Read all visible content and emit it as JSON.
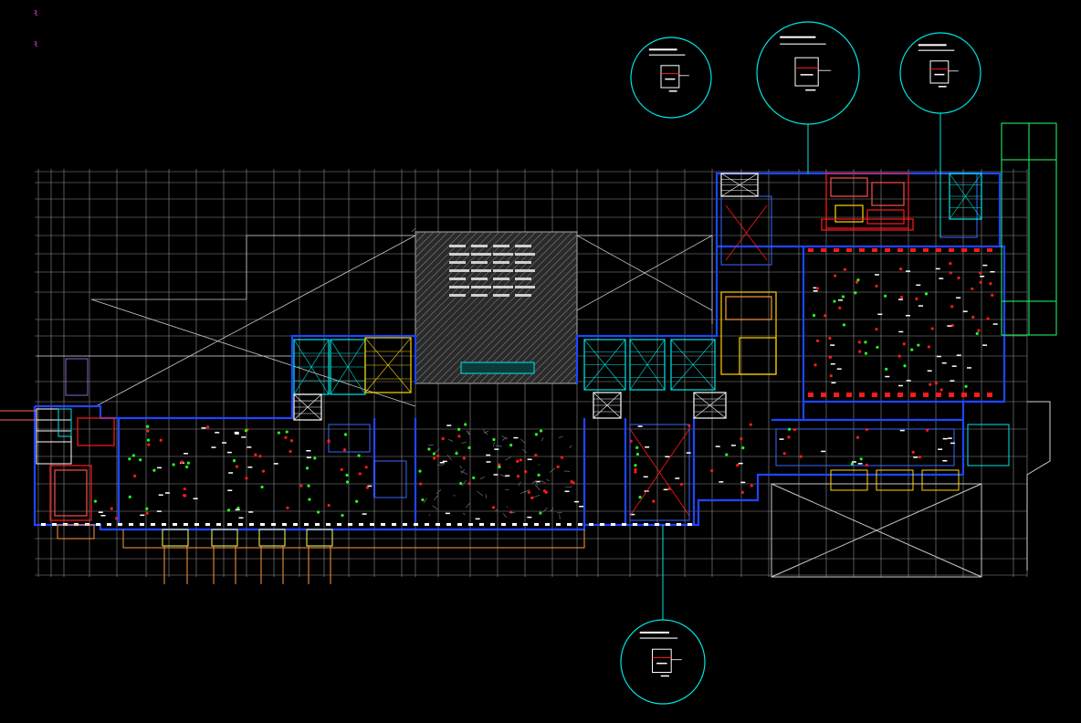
{
  "drawing": {
    "background": "#000000",
    "colors": {
      "grid": "#9a9a9a",
      "wall": "#1e46ff",
      "equipment": "#ff1a1a",
      "cyan": "#00e5e5",
      "yellow": "#ffd400",
      "green": "#22ff22",
      "white": "#ffffff",
      "magenta": "#ff33ff",
      "orange": "#ff9a3c",
      "hatch": "#8a8a8a"
    },
    "ucs_markers": [
      "ł",
      "ł"
    ],
    "detail_callouts": [
      {
        "id": "callout-top-left",
        "shape": "detail-circle"
      },
      {
        "id": "callout-top-center",
        "shape": "detail-circle"
      },
      {
        "id": "callout-top-right",
        "shape": "detail-circle"
      },
      {
        "id": "callout-bottom",
        "shape": "detail-circle"
      }
    ]
  }
}
